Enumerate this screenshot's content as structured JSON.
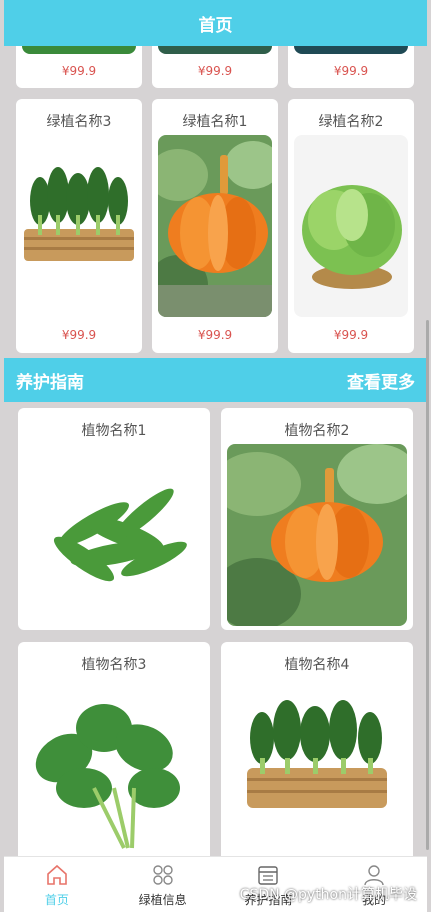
{
  "header": {
    "title": "首页"
  },
  "top_row": {
    "prices": [
      "¥99.9",
      "¥99.9",
      "¥99.9"
    ]
  },
  "plants": [
    {
      "name": "绿植名称3",
      "price": "¥99.9",
      "image": "bok-choy-basket"
    },
    {
      "name": "绿植名称1",
      "price": "¥99.9",
      "image": "pumpkin"
    },
    {
      "name": "绿植名称2",
      "price": "¥99.9",
      "image": "lettuce-basket"
    }
  ],
  "care_section": {
    "title": "养护指南",
    "more": "查看更多"
  },
  "care_items": [
    {
      "name": "植物名称1",
      "image": "snow-peas"
    },
    {
      "name": "植物名称2",
      "image": "pumpkin"
    },
    {
      "name": "植物名称3",
      "image": "spinach"
    },
    {
      "name": "植物名称4",
      "image": "bok-choy-basket"
    }
  ],
  "tabbar": {
    "items": [
      {
        "label": "首页",
        "icon": "home-icon",
        "active": true
      },
      {
        "label": "绿植信息",
        "icon": "grid-icon",
        "active": false
      },
      {
        "label": "养护指南",
        "icon": "calendar-icon",
        "active": false
      },
      {
        "label": "我的",
        "icon": "user-icon",
        "active": false
      }
    ]
  },
  "colors": {
    "accent": "#4fcfe8",
    "price": "#d9534f",
    "background": "#d6d3d4"
  },
  "watermark": "CSDN @python计算机毕设"
}
